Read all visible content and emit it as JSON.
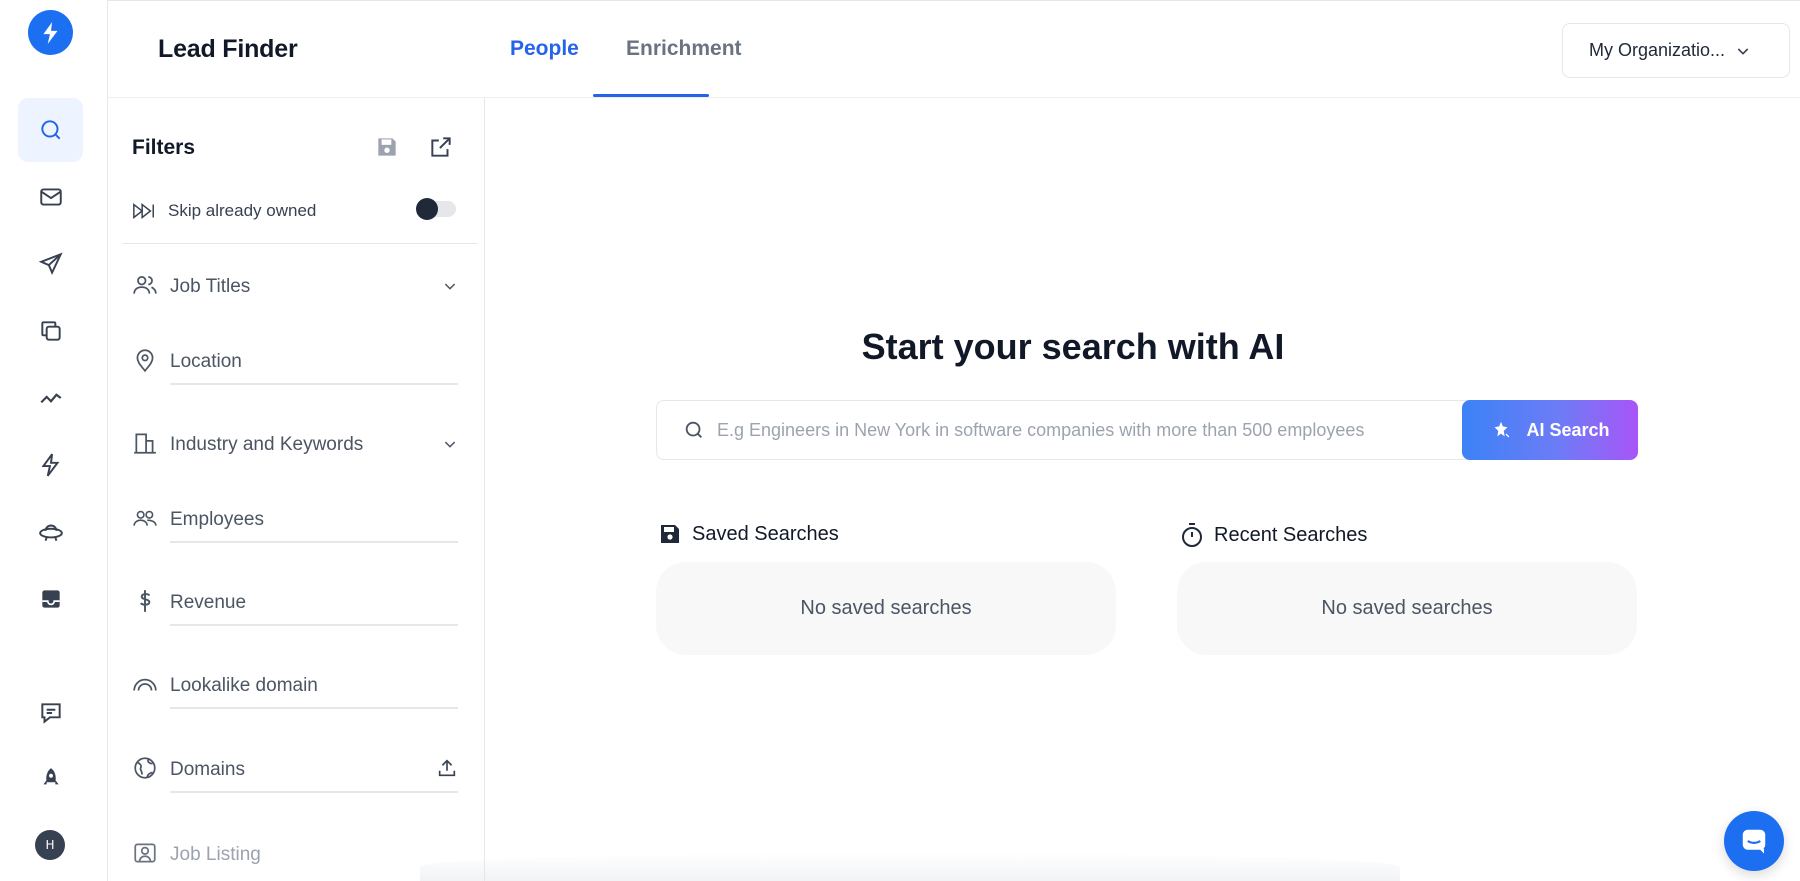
{
  "app": {
    "title": "Lead Finder",
    "accent_color": "#2563eb",
    "brand_color": "#1d6ff2"
  },
  "rail": {
    "logo_icon": "bolt-logo-icon",
    "items": [
      {
        "name": "search-icon",
        "active": true
      },
      {
        "name": "mail-icon",
        "active": false
      },
      {
        "name": "send-icon",
        "active": false
      },
      {
        "name": "copy-icon",
        "active": false
      },
      {
        "name": "trend-icon",
        "active": false
      },
      {
        "name": "bolt-icon",
        "active": false
      },
      {
        "name": "ufo-icon",
        "active": false
      },
      {
        "name": "inbox-icon",
        "active": false
      },
      {
        "name": "feedback-icon",
        "active": false
      },
      {
        "name": "rocket-icon",
        "active": false
      }
    ],
    "avatar_initial": "H"
  },
  "header": {
    "tabs": [
      {
        "label": "People",
        "active": true
      },
      {
        "label": "Enrichment",
        "active": false
      }
    ],
    "org_selector": "My Organizatio..."
  },
  "filters": {
    "title": "Filters",
    "skip_label": "Skip already owned",
    "skip_enabled": false,
    "items": [
      {
        "label": "Job Titles",
        "icon": "users-icon",
        "expandable": true
      },
      {
        "label": "Location",
        "icon": "map-pin-icon"
      },
      {
        "label": "Industry and Keywords",
        "icon": "building-icon",
        "expandable": true
      },
      {
        "label": "Employees",
        "icon": "people-icon"
      },
      {
        "label": "Revenue",
        "icon": "dollar-icon"
      },
      {
        "label": "Lookalike domain",
        "icon": "rainbow-icon"
      },
      {
        "label": "Domains",
        "icon": "globe-icon",
        "upload": true
      },
      {
        "label": "Job Listing",
        "icon": "id-card-icon"
      }
    ]
  },
  "main": {
    "hero_title": "Start your search with AI",
    "search_placeholder": "E.g Engineers in New York in software companies with more than 500 employees",
    "search_value": "",
    "ai_button": "AI Search",
    "saved": {
      "title": "Saved Searches",
      "empty": "No saved searches"
    },
    "recent": {
      "title": "Recent Searches",
      "empty": "No saved searches"
    }
  }
}
